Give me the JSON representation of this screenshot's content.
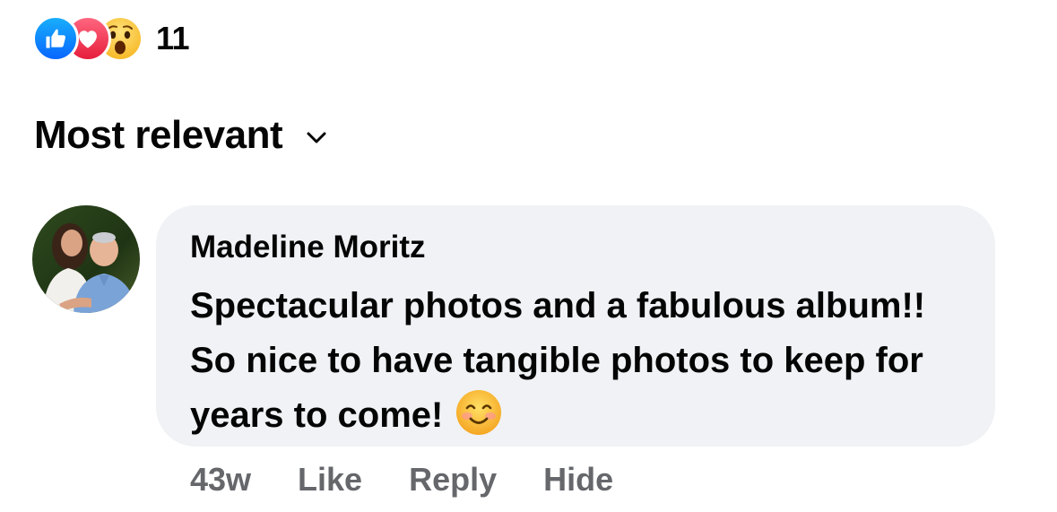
{
  "reactions": {
    "icons": [
      "like-reaction",
      "love-reaction",
      "wow-reaction"
    ],
    "count": "11",
    "colors": {
      "like": "#0866ff",
      "love": "#f33e58",
      "wow": "#ffcc4d"
    }
  },
  "sort": {
    "label": "Most relevant",
    "icon": "chevron-down-icon"
  },
  "comment": {
    "author": "Madeline Moritz",
    "text": "Spectacular photos and a fabulous album!! So nice to have tangible photos to keep for years to come!",
    "emoji": "smiling-face-emoji",
    "timestamp": "43w",
    "actions": {
      "like": "Like",
      "reply": "Reply",
      "hide": "Hide"
    }
  },
  "colors": {
    "bubble_bg": "#f0f2f5",
    "secondary_text": "#65676b",
    "primary_text": "#050505"
  }
}
